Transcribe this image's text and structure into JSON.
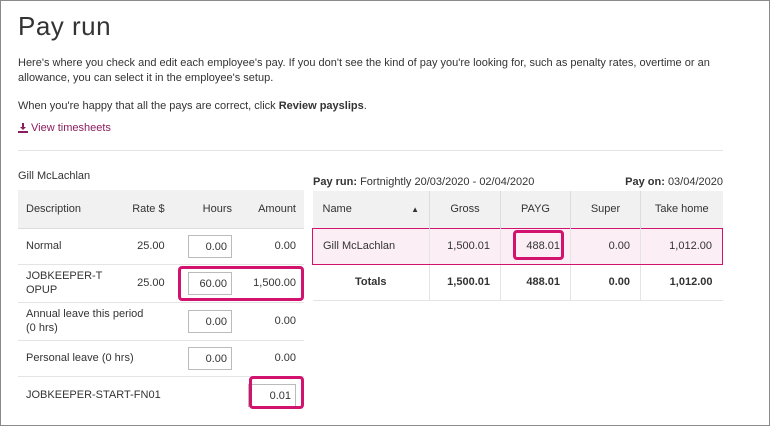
{
  "page": {
    "title": "Pay run",
    "intro": "Here's where you check and edit each employee's pay. If you don't see the kind of pay you're looking for, such as penalty rates, overtime or an allowance, you can select it in the employee's setup.",
    "instruction_prefix": "When you're happy that all the pays are correct, click ",
    "instruction_bold": "Review payslips",
    "instruction_suffix": ".",
    "view_timesheets": "View timesheets"
  },
  "employee": {
    "name": "Gill McLachlan",
    "columns": {
      "description": "Description",
      "rate": "Rate $",
      "hours": "Hours",
      "amount": "Amount"
    },
    "rows": [
      {
        "description": "Normal",
        "rate": "25.00",
        "hours": "0.00",
        "amount": "0.00"
      },
      {
        "description": "JOBKEEPER-TOPUP",
        "rate": "25.00",
        "hours": "60.00",
        "amount": "1,500.00"
      },
      {
        "description": "Annual leave this period (0 hrs)",
        "rate": "",
        "hours": "0.00",
        "amount": "0.00"
      },
      {
        "description": "Personal leave (0 hrs)",
        "rate": "",
        "hours": "0.00",
        "amount": "0.00"
      },
      {
        "description": "JOBKEEPER-START-FN01",
        "rate": "",
        "hours": "",
        "amount": "0.01"
      }
    ]
  },
  "payrun": {
    "label": "Pay run:",
    "period": "Fortnightly 20/03/2020 - 02/04/2020",
    "payon_label": "Pay on:",
    "payon_date": "03/04/2020",
    "columns": {
      "name": "Name",
      "gross": "Gross",
      "payg": "PAYG",
      "super": "Super",
      "take_home": "Take home"
    },
    "row": {
      "name": "Gill McLachlan",
      "gross": "1,500.01",
      "payg": "488.01",
      "super": "0.00",
      "take_home": "1,012.00"
    },
    "totals": {
      "label": "Totals",
      "gross": "1,500.01",
      "payg": "488.01",
      "super": "0.00",
      "take_home": "1,012.00"
    }
  },
  "colors": {
    "accent": "#8a1d5c",
    "highlight": "#d1136f",
    "selected_row": "#fbeef4"
  },
  "icons": {
    "view_timesheets": "download-icon",
    "sort": "sort-up-icon"
  }
}
